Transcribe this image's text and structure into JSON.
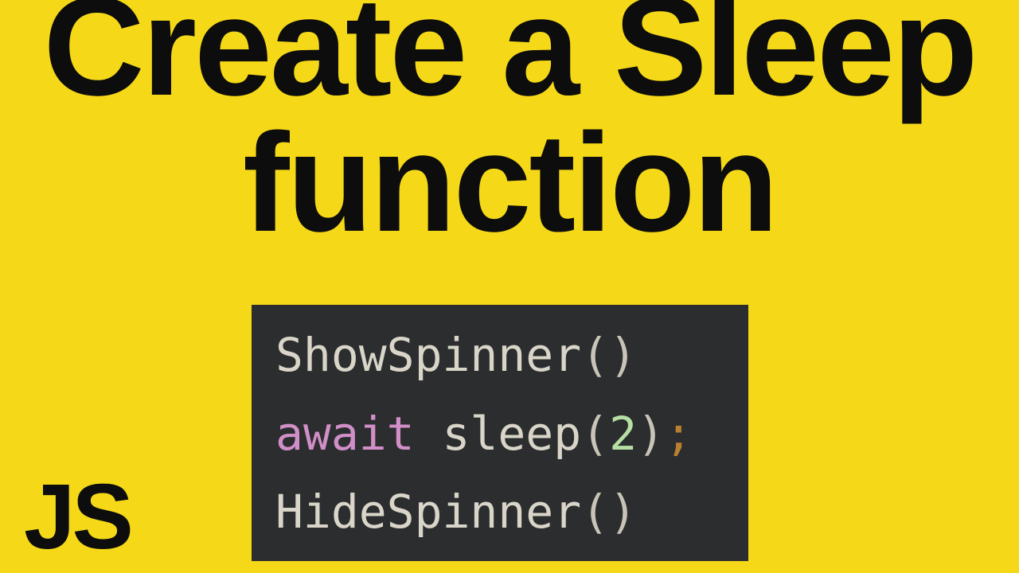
{
  "headline": {
    "line1": "Create a Sleep",
    "line2": "function"
  },
  "code": {
    "line1": {
      "fn": "ShowSpinner",
      "parens": "()"
    },
    "line2": {
      "kw": "await",
      "sp": " ",
      "fn": "sleep",
      "open": "(",
      "arg": "2",
      "close": ")",
      "semi": ";"
    },
    "line3": {
      "fn": "HideSpinner",
      "parens": "()"
    }
  },
  "corner": "JS"
}
